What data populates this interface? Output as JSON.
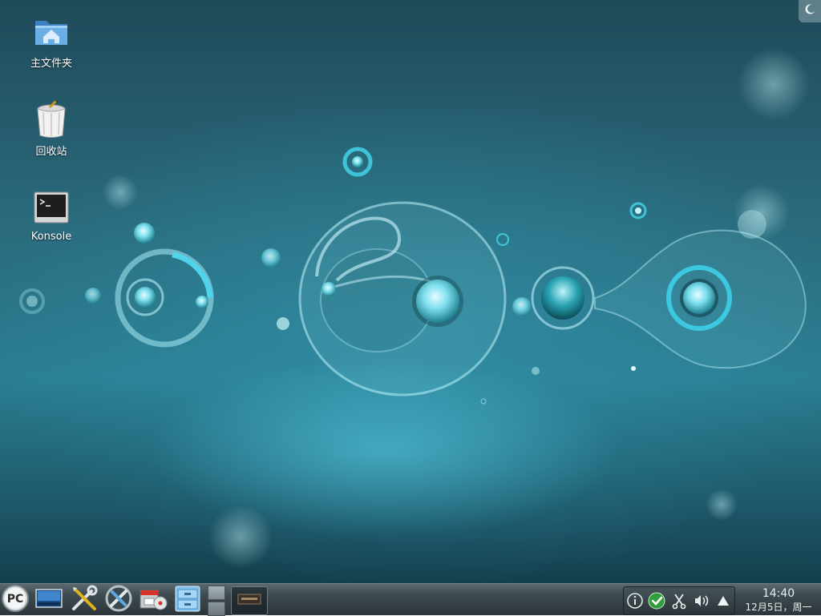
{
  "desktop": {
    "icons": [
      {
        "label": "主文件夹",
        "icon": "home-folder-icon"
      },
      {
        "label": "回收站",
        "icon": "trash-bin-icon"
      },
      {
        "label": "Konsole",
        "icon": "terminal-icon"
      }
    ],
    "cashew_icon": "desktop-toolbox-icon"
  },
  "panel": {
    "launchers": [
      {
        "name": "application-launcher",
        "icon": "pc-logo-icon",
        "text": "PC"
      },
      {
        "name": "show-desktop",
        "icon": "desktop-display-icon"
      },
      {
        "name": "system-settings",
        "icon": "tools-icon"
      },
      {
        "name": "control-center",
        "icon": "tools-gear-icon"
      },
      {
        "name": "software-installer",
        "icon": "package-installer-icon"
      },
      {
        "name": "file-manager",
        "icon": "file-cabinet-icon"
      }
    ],
    "pager": {
      "desktops": 2,
      "active": 1
    },
    "tray_icons": [
      "info-icon",
      "update-check-icon",
      "klipper-scissors-icon",
      "volume-icon",
      "expand-tray-icon"
    ],
    "clock": {
      "time": "14:40",
      "date": "12月5日，周一"
    }
  },
  "colors": {
    "wallpaper_accent": "#5fd6ea",
    "panel_dark": "#2c3539"
  }
}
